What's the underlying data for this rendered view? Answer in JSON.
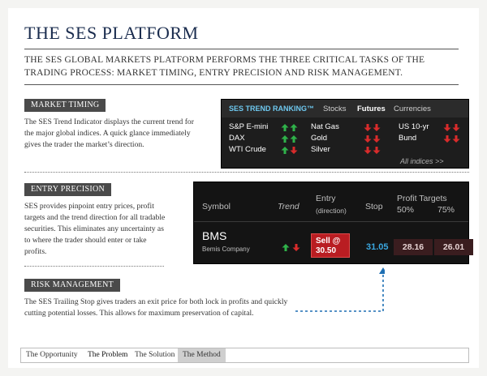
{
  "page": {
    "title": "THE SES PLATFORM",
    "intro": "THE SES GLOBAL MARKETS PLATFORM PERFORMS THE THREE CRITICAL TASKS OF THE TRADING PROCESS: MARKET TIMING, ENTRY PRECISION AND RISK MANAGEMENT."
  },
  "sections": {
    "market_timing": {
      "label": "MARKET TIMING",
      "text_lines": [
        "The SES Trend Indicator displays the current trend for",
        "the major global indices. A quick glance immediately",
        "gives the trader the market’s direction."
      ]
    },
    "entry_precision": {
      "label": "ENTRY PRECISION",
      "text_lines": [
        "SES provides pinpoint entry prices, profit",
        "targets and the trend direction for all tradable",
        "securities. This eliminates any uncertainty as",
        "to where the trader should enter or take",
        "profits."
      ]
    },
    "risk_management": {
      "label": "RISK MANAGEMENT",
      "text_lines": [
        "The SES Trailing Stop gives traders an exit price for both lock in profits and quickly",
        "cutting potential losses. This allows for maximum preservation of capital."
      ]
    }
  },
  "trend_widget": {
    "brand": "SES TREND RANKING™",
    "tabs": [
      {
        "label": "Stocks",
        "active": false
      },
      {
        "label": "Futures",
        "active": true
      },
      {
        "label": "Currencies",
        "active": false
      }
    ],
    "rows": [
      [
        {
          "name": "S&P E-mini",
          "arrows": [
            "up",
            "up"
          ]
        },
        {
          "name": "Nat Gas",
          "arrows": [
            "down",
            "down"
          ]
        },
        {
          "name": "US 10-yr",
          "arrows": [
            "down",
            "down"
          ]
        }
      ],
      [
        {
          "name": "DAX",
          "arrows": [
            "up",
            "up"
          ]
        },
        {
          "name": "Gold",
          "arrows": [
            "down",
            "down"
          ]
        },
        {
          "name": "Bund",
          "arrows": [
            "down",
            "down"
          ]
        }
      ],
      [
        {
          "name": "WTI Crude",
          "arrows": [
            "up",
            "down"
          ]
        },
        {
          "name": "Silver",
          "arrows": [
            "down",
            "down"
          ]
        }
      ]
    ],
    "all_link": "All indices >>"
  },
  "entry_widget": {
    "headers": {
      "symbol": "Symbol",
      "trend": "Trend",
      "entry": "Entry",
      "entry_sub": "(direction)",
      "stop": "Stop",
      "targets": "Profit Targets",
      "t50": "50%",
      "t75": "75%"
    },
    "row": {
      "symbol": "BMS",
      "company": "Bemis Company",
      "trend_arrows": [
        "up",
        "down"
      ],
      "sell_line1": "Sell @",
      "sell_line2": "30.50",
      "stop": "31.05",
      "target50": "28.16",
      "target75": "26.01"
    }
  },
  "nav": {
    "items": [
      {
        "label": "The Opportunity",
        "bold": false,
        "selected": false
      },
      {
        "label": "The Problem",
        "bold": true,
        "selected": false
      },
      {
        "label": "The Solution",
        "bold": false,
        "selected": false
      },
      {
        "label": "The Method",
        "bold": false,
        "selected": true
      }
    ]
  },
  "colors": {
    "title": "#1a2c4e",
    "up_arrow": "#2fb24a",
    "down_arrow": "#d92b2b",
    "brand_blue": "#6ec8ef",
    "stop_blue": "#3aa7e0",
    "sell_red": "#b91d22",
    "connector_blue": "#1e6fb3"
  },
  "icons": {
    "up": "arrow-up-icon",
    "down": "arrow-down-icon"
  }
}
